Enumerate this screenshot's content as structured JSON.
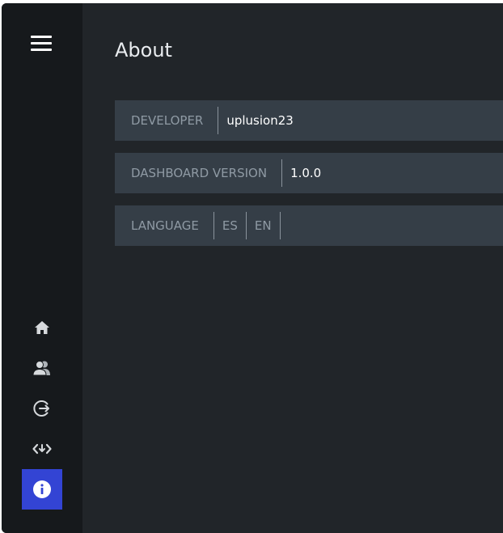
{
  "page": {
    "title": "About"
  },
  "info_rows": {
    "developer": {
      "label": "DEVELOPER",
      "value": "uplusion23"
    },
    "dashboard_version": {
      "label": "DASHBOARD VERSION",
      "value": "1.0.0"
    },
    "language": {
      "label": "LANGUAGE",
      "options": [
        "ES",
        "EN"
      ]
    }
  },
  "sidebar": {
    "menu_icon": "hamburger-icon",
    "items": [
      {
        "icon": "home-icon",
        "active": false
      },
      {
        "icon": "users-icon",
        "active": false
      },
      {
        "icon": "logout-icon",
        "active": false
      },
      {
        "icon": "code-icon",
        "active": false
      },
      {
        "icon": "info-icon",
        "active": true
      }
    ]
  },
  "colors": {
    "background": "#212529",
    "sidebar": "#16191c",
    "row": "#353e47",
    "active_accent": "#3344d4",
    "label_text": "#8f9aa4",
    "value_text": "#ffffff"
  }
}
